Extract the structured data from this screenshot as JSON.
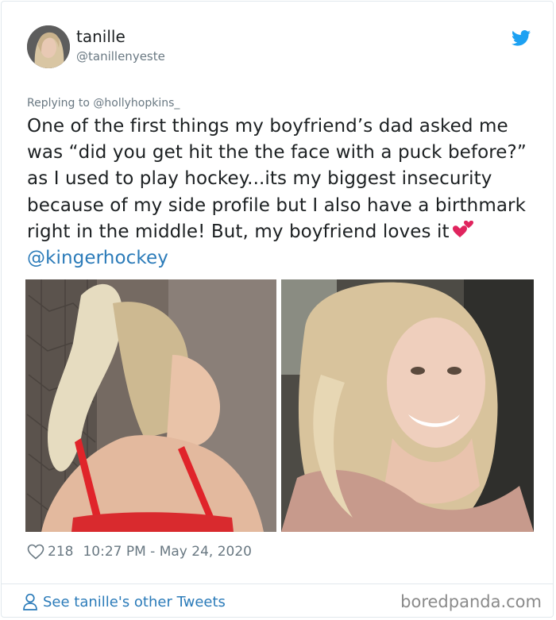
{
  "author": {
    "display_name": "tanille",
    "handle": "@tanillenyeste"
  },
  "tweet": {
    "replying_to": "Replying to @hollyhopkins_",
    "text": "One of the first things my boyfriend’s dad asked me was “did you get hit the the face with a puck before?” as I used to play hockey...its my biggest insecurity because of my side profile but I also have a birthmark right in the middle! But, my boyfriend loves it",
    "emoji": "two-hearts",
    "mention": "@kingerhockey",
    "likes": "218",
    "timestamp": "10:27 PM - May 24, 2020"
  },
  "footer": {
    "see_more": "See tanille's other Tweets",
    "watermark": "boredpanda.com"
  },
  "icons": {
    "brand": "twitter-bird-icon",
    "like": "heart-outline-icon",
    "profile": "person-icon"
  },
  "colors": {
    "link": "#2b7bb9",
    "twitter_blue": "#1da1f2",
    "meta_gray": "#697882"
  }
}
